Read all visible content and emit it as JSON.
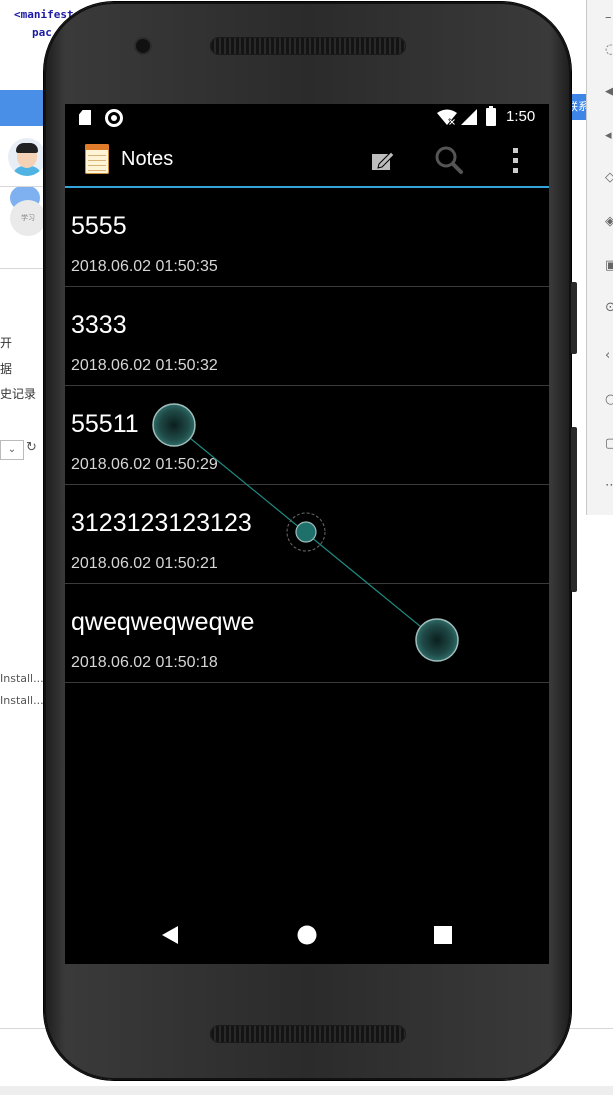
{
  "desktop": {
    "code_lines": [
      "<manifest",
      "pac"
    ],
    "left_chip_text": "学习",
    "left_texts": [
      "开",
      "据",
      "史记录"
    ],
    "install_items": [
      "Install...",
      "Install..."
    ],
    "right_tag_text": "联系"
  },
  "device": {
    "status_bar": {
      "time": "1:50",
      "icons": [
        "sd-card-icon",
        "sync-circle-icon",
        "wifi-icon",
        "cell-signal-icon",
        "battery-icon"
      ]
    },
    "action_bar": {
      "title": "Notes",
      "icons": [
        "notes-app-icon",
        "new-note-icon",
        "search-icon",
        "overflow-menu-icon"
      ],
      "accent_color": "#33a3da"
    },
    "notes": [
      {
        "title": "5555",
        "date": "2018.06.02 01:50:35"
      },
      {
        "title": "3333",
        "date": "2018.06.02 01:50:32"
      },
      {
        "title": "55511",
        "date": "2018.06.02 01:50:29"
      },
      {
        "title": "3123123123123",
        "date": "2018.06.02 01:50:21"
      },
      {
        "title": "qweqweqweqwe",
        "date": "2018.06.02 01:50:18"
      }
    ],
    "nav_bar": {
      "icons": [
        "back-icon",
        "home-icon",
        "recents-icon"
      ]
    },
    "touch_indicator_color": "#1f6f6a"
  }
}
